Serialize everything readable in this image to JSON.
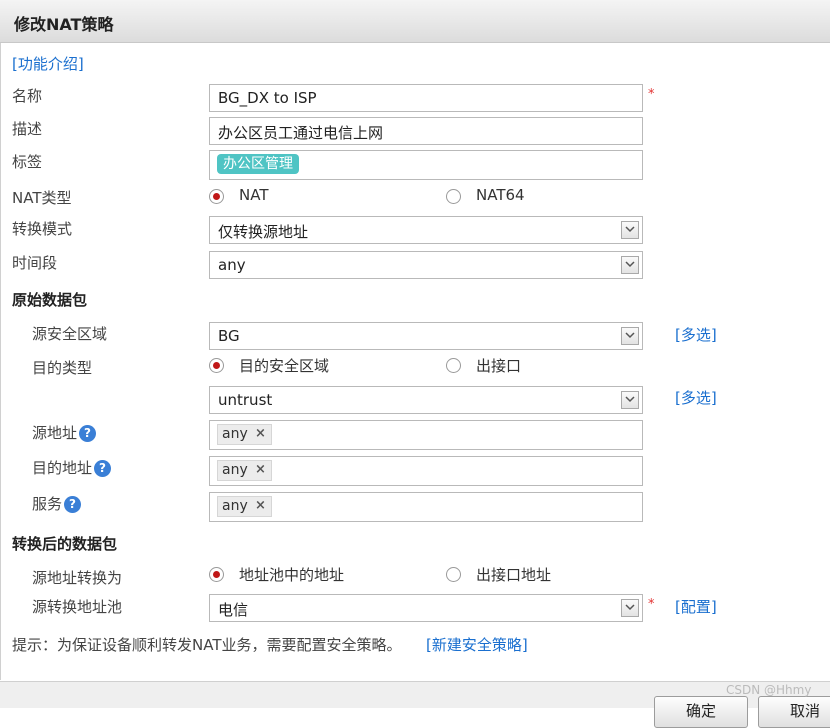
{
  "dialog": {
    "title": "修改NAT策略"
  },
  "intro_link": "[功能介绍]",
  "fields": {
    "name": {
      "label": "名称",
      "value": "BG_DX to ISP",
      "required": "*"
    },
    "desc": {
      "label": "描述",
      "value": "办公区员工通过电信上网"
    },
    "tag": {
      "label": "标签",
      "value": "办公区管理"
    },
    "nat_type": {
      "label": "NAT类型",
      "options": [
        "NAT",
        "NAT64"
      ],
      "selected": "NAT"
    },
    "mode": {
      "label": "转换模式",
      "value": "仅转换源地址"
    },
    "schedule": {
      "label": "时间段",
      "value": "any"
    }
  },
  "original": {
    "heading": "原始数据包",
    "src_zone": {
      "label": "源安全区域",
      "value": "BG",
      "multi": "[多选]"
    },
    "dst_type": {
      "label": "目的类型",
      "options": [
        "目的安全区域",
        "出接口"
      ],
      "selected": "目的安全区域"
    },
    "dst_zone": {
      "value": "untrust",
      "multi": "[多选]"
    },
    "src_addr": {
      "label": "源地址",
      "chip": "any",
      "remove": "×"
    },
    "dst_addr": {
      "label": "目的地址",
      "chip": "any",
      "remove": "×"
    },
    "service": {
      "label": "服务",
      "chip": "any",
      "remove": "×"
    }
  },
  "translated": {
    "heading": "转换后的数据包",
    "src_trans": {
      "label": "源地址转换为",
      "options": [
        "地址池中的地址",
        "出接口地址"
      ],
      "selected": "地址池中的地址"
    },
    "pool": {
      "label": "源转换地址池",
      "value": "电信",
      "required": "*",
      "config": "[配置]"
    }
  },
  "hint": {
    "text": "提示：为保证设备顺利转发NAT业务，需要配置安全策略。",
    "link": "[新建安全策略]"
  },
  "help_glyph": "?",
  "buttons": {
    "ok": "确定",
    "cancel": "取消"
  },
  "watermark": "CSDN @Hhmy",
  "colors": {
    "link": "#1a6fcf",
    "required": "#e23232",
    "tag_bg": "#4fc4c4",
    "radio_dot": "#c01818"
  }
}
